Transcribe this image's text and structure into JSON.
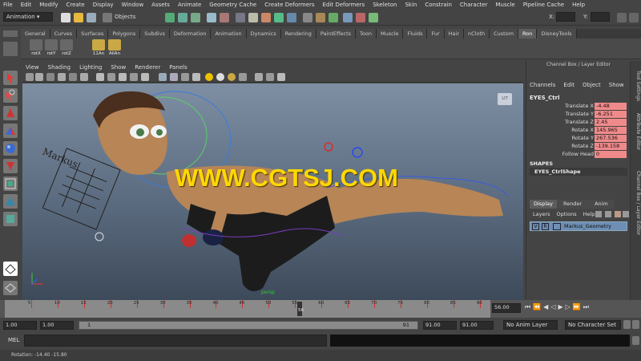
{
  "menubar": [
    "File",
    "Edit",
    "Modify",
    "Create",
    "Display",
    "Window",
    "Assets",
    "Animate",
    "Geometry Cache",
    "Create Deformers",
    "Edit Deformers",
    "Skeleton",
    "Skin",
    "Constrain",
    "Character",
    "Muscle",
    "Pipeline Cache",
    "Help"
  ],
  "status": {
    "mode": "Animation",
    "objects_label": "Objects",
    "x_label": "X:",
    "y_label": "Y:"
  },
  "shelf_tabs": [
    "General",
    "Curves",
    "Surfaces",
    "Polygons",
    "Subdivs",
    "Deformation",
    "Animation",
    "Dynamics",
    "Rendering",
    "PaintEffects",
    "Toon",
    "Muscle",
    "Fluids",
    "Fur",
    "Hair",
    "nCloth",
    "Custom",
    "Ron",
    "DisneyTools"
  ],
  "shelf_active": "Ron",
  "shelf_buttons": [
    "rotX",
    "rotY",
    "rotZ",
    "11An",
    "AllAn"
  ],
  "viewport_menu": [
    "View",
    "Shading",
    "Lighting",
    "Show",
    "Renderer",
    "Panels"
  ],
  "viewport": {
    "persp_label": "persp",
    "cam_label": "LIT",
    "rig_name": "Markus"
  },
  "watermark": "WWW.CGTSJ.COM",
  "channel_box": {
    "title": "Channel Box / Layer Editor",
    "menu": [
      "Channels",
      "Edit",
      "Object",
      "Show"
    ],
    "object": "EYES_Ctrl",
    "attrs": [
      {
        "label": "Translate X",
        "value": "-4.48"
      },
      {
        "label": "Translate Y",
        "value": "-6.251"
      },
      {
        "label": "Translate Z",
        "value": "2.45"
      },
      {
        "label": "Rotate X",
        "value": "145.965"
      },
      {
        "label": "Rotate Y",
        "value": "267.536"
      },
      {
        "label": "Rotate Z",
        "value": "-139.158"
      },
      {
        "label": "Follow Head",
        "value": "0"
      }
    ],
    "shapes_label": "SHAPES",
    "shape": "EYES_CtrlShape"
  },
  "layer_editor": {
    "tabs": [
      "Display",
      "Render",
      "Anim"
    ],
    "menu": [
      "Layers",
      "Options",
      "Help"
    ],
    "layer": {
      "v": "V",
      "r": "R",
      "name": "Markus_Geometry"
    }
  },
  "side_tabs": [
    "Tool Settings",
    "Attribute Editor",
    "Channel Box / Layer Editor"
  ],
  "timeline": {
    "ticks": [
      "5",
      "10",
      "15",
      "20",
      "25",
      "30",
      "35",
      "40",
      "45",
      "50",
      "55",
      "60",
      "65",
      "70",
      "75",
      "80",
      "85",
      "90"
    ],
    "current": "56",
    "current_field": "56.00"
  },
  "range": {
    "start": "1.00",
    "anim_start": "1.00",
    "slider_start": "1",
    "slider_end": "91",
    "anim_end": "91.00",
    "end": "91.00",
    "anim_layer": "No Anim Layer",
    "character": "No Character Set"
  },
  "cmd": {
    "label": "MEL"
  },
  "help": {
    "text": "Rotation: -14.40  -15.80"
  }
}
